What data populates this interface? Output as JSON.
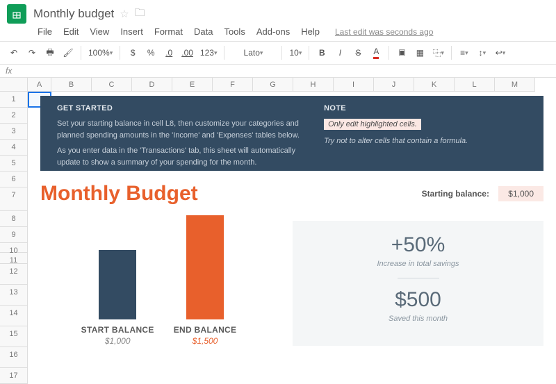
{
  "doc": {
    "title": "Monthly budget",
    "last_edit": "Last edit was seconds ago"
  },
  "menu": {
    "file": "File",
    "edit": "Edit",
    "view": "View",
    "insert": "Insert",
    "format": "Format",
    "data": "Data",
    "tools": "Tools",
    "addons": "Add-ons",
    "help": "Help"
  },
  "toolbar": {
    "zoom": "100%",
    "currency": "$",
    "percent": "%",
    "dec_dec": ".0",
    "dec_inc": ".00",
    "fmt": "123",
    "font": "Lato",
    "size": "10"
  },
  "fx": {
    "label": "fx"
  },
  "cols": [
    "A",
    "B",
    "C",
    "D",
    "E",
    "F",
    "G",
    "H",
    "I",
    "J",
    "K",
    "L",
    "M"
  ],
  "rows": [
    "1",
    "2",
    "3",
    "4",
    "5",
    "6",
    "7",
    "8",
    "9",
    "10",
    "11",
    "12",
    "13",
    "14",
    "15",
    "16",
    "17"
  ],
  "banner": {
    "left_title": "GET STARTED",
    "left_p1": "Set your starting balance in cell L8, then customize your categories and planned spending amounts in the 'Income' and 'Expenses' tables below.",
    "left_p2": "As you enter data in the 'Transactions' tab, this sheet will automatically update to show a summary of your spending for the month.",
    "right_title": "NOTE",
    "highlight": "Only edit highlighted cells.",
    "formula_note": "Try not to alter cells that contain a formula."
  },
  "content": {
    "title": "Monthly Budget",
    "start_label": "Starting balance:",
    "start_value": "$1,000",
    "bar1_label": "START BALANCE",
    "bar1_value": "$1,000",
    "bar2_label": "END BALANCE",
    "bar2_value": "$1,500",
    "pct": "+50%",
    "pct_sub": "Increase in total savings",
    "saved": "$500",
    "saved_sub": "Saved this month"
  },
  "chart_data": {
    "type": "bar",
    "categories": [
      "START BALANCE",
      "END BALANCE"
    ],
    "values": [
      1000,
      1500
    ],
    "title": "",
    "xlabel": "",
    "ylabel": "",
    "ylim": [
      0,
      1500
    ]
  }
}
